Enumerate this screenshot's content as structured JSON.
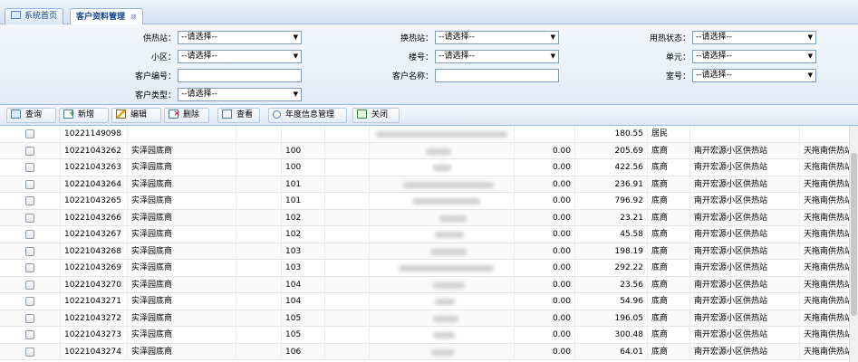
{
  "tabs": [
    {
      "label": "系统首页",
      "icon": "home-icon",
      "active": false
    },
    {
      "label": "客户资料管理",
      "icon": "",
      "active": true,
      "closable": true
    }
  ],
  "filters": {
    "heat_station": {
      "label": "供热站：",
      "value": "--请选择--"
    },
    "exchange_station": {
      "label": "换热站：",
      "value": "--请选择--"
    },
    "heat_status": {
      "label": "用热状态：",
      "value": "--请选择--"
    },
    "community": {
      "label": "小区：",
      "value": "--请选择--"
    },
    "building": {
      "label": "楼号：",
      "value": "--请选择--"
    },
    "unit": {
      "label": "单元：",
      "value": "--请选择--"
    },
    "customer_no": {
      "label": "客户编号：",
      "value": ""
    },
    "customer_name": {
      "label": "客户名称：",
      "value": ""
    },
    "room": {
      "label": "室号：",
      "value": "--请选择--"
    },
    "customer_type": {
      "label": "客户类型：",
      "value": "--请选择--"
    }
  },
  "toolbar": {
    "query": "查询",
    "add": "新增",
    "edit": "编辑",
    "delete": "删除",
    "view": "查看",
    "annual": "年度信息管理",
    "close": "关闭"
  },
  "rows": [
    {
      "id": "10221149098",
      "community": "",
      "building": "",
      "amount": "",
      "area": "180.55",
      "type": "居民",
      "station": "",
      "exchange": ""
    },
    {
      "id": "10221043262",
      "community": "实泽园底商",
      "building": "100",
      "amount": "0.00",
      "area": "205.69",
      "type": "底商",
      "station": "南开宏源小区供热站",
      "exchange": "天拖南供热站"
    },
    {
      "id": "10221043263",
      "community": "实泽园底商",
      "building": "100",
      "amount": "0.00",
      "area": "422.56",
      "type": "底商",
      "station": "南开宏源小区供热站",
      "exchange": "天拖南供热站"
    },
    {
      "id": "10221043264",
      "community": "实泽园底商",
      "building": "101",
      "amount": "0.00",
      "area": "236.91",
      "type": "底商",
      "station": "南开宏源小区供热站",
      "exchange": "天拖南供热站"
    },
    {
      "id": "10221043265",
      "community": "实泽园底商",
      "building": "101",
      "amount": "0.00",
      "area": "796.92",
      "type": "底商",
      "station": "南开宏源小区供热站",
      "exchange": "天拖南供热站"
    },
    {
      "id": "10221043266",
      "community": "实泽园底商",
      "building": "102",
      "amount": "0.00",
      "area": "23.21",
      "type": "底商",
      "station": "南开宏源小区供热站",
      "exchange": "天拖南供热站"
    },
    {
      "id": "10221043267",
      "community": "实泽园底商",
      "building": "102",
      "amount": "0.00",
      "area": "45.58",
      "type": "底商",
      "station": "南开宏源小区供热站",
      "exchange": "天拖南供热站"
    },
    {
      "id": "10221043268",
      "community": "实泽园底商",
      "building": "103",
      "amount": "0.00",
      "area": "198.19",
      "type": "底商",
      "station": "南开宏源小区供热站",
      "exchange": "天拖南供热站"
    },
    {
      "id": "10221043269",
      "community": "实泽园底商",
      "building": "103",
      "amount": "0.00",
      "area": "292.22",
      "type": "底商",
      "station": "南开宏源小区供热站",
      "exchange": "天拖南供热站"
    },
    {
      "id": "10221043270",
      "community": "实泽园底商",
      "building": "104",
      "amount": "0.00",
      "area": "23.56",
      "type": "底商",
      "station": "南开宏源小区供热站",
      "exchange": "天拖南供热站"
    },
    {
      "id": "10221043271",
      "community": "实泽园底商",
      "building": "104",
      "amount": "0.00",
      "area": "54.96",
      "type": "底商",
      "station": "南开宏源小区供热站",
      "exchange": "天拖南供热站"
    },
    {
      "id": "10221043272",
      "community": "实泽园底商",
      "building": "105",
      "amount": "0.00",
      "area": "196.05",
      "type": "底商",
      "station": "南开宏源小区供热站",
      "exchange": "天拖南供热站"
    },
    {
      "id": "10221043273",
      "community": "实泽园底商",
      "building": "105",
      "amount": "0.00",
      "area": "300.48",
      "type": "底商",
      "station": "南开宏源小区供热站",
      "exchange": "天拖南供热站"
    },
    {
      "id": "10221043274",
      "community": "实泽园底商",
      "building": "106",
      "amount": "0.00",
      "area": "64.01",
      "type": "底商",
      "station": "南开宏源小区供热站",
      "exchange": "天拖南供热站"
    }
  ]
}
